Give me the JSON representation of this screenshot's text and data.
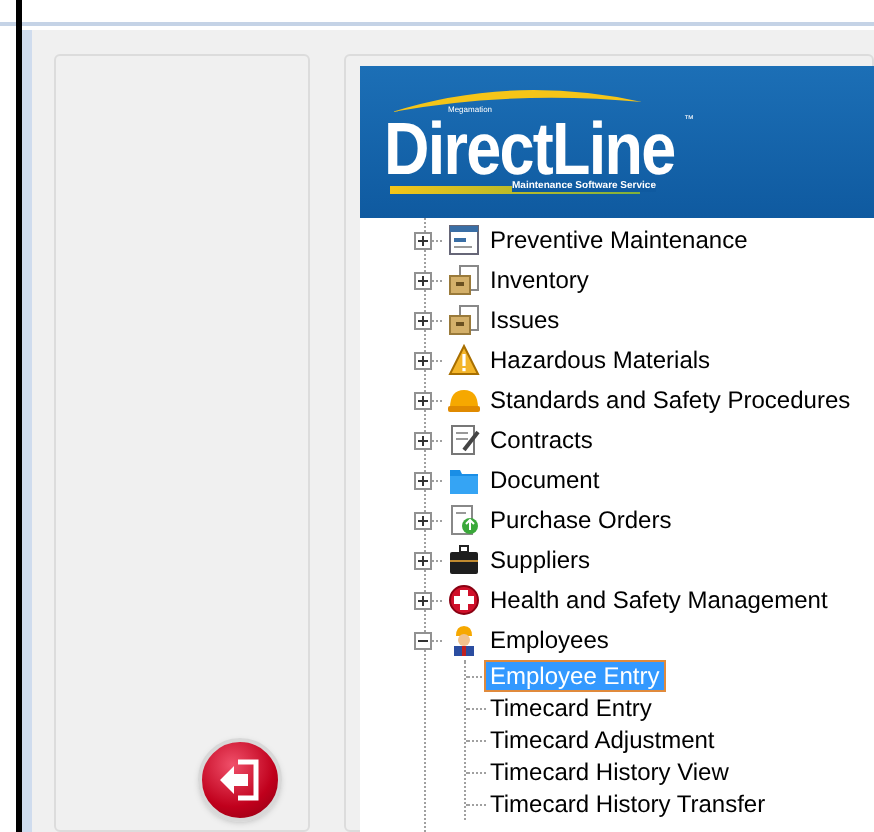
{
  "logo": {
    "brand": "DirectLine",
    "maker": "Megamation",
    "tagline": "Maintenance Software Service",
    "trademark": "™"
  },
  "tree": [
    {
      "label": "Preventive Maintenance",
      "kind": "form",
      "expanded": false
    },
    {
      "label": "Inventory",
      "kind": "box",
      "expanded": false
    },
    {
      "label": "Issues",
      "kind": "box",
      "expanded": false
    },
    {
      "label": "Hazardous Materials",
      "kind": "warning",
      "expanded": false
    },
    {
      "label": "Standards and Safety Procedures",
      "kind": "hardhat",
      "expanded": false
    },
    {
      "label": "Contracts",
      "kind": "note",
      "expanded": false
    },
    {
      "label": "Document",
      "kind": "folder",
      "expanded": false
    },
    {
      "label": "Purchase Orders",
      "kind": "order",
      "expanded": false
    },
    {
      "label": "Suppliers",
      "kind": "briefcase",
      "expanded": false
    },
    {
      "label": "Health and Safety Management",
      "kind": "cross",
      "expanded": false
    },
    {
      "label": "Employees",
      "kind": "worker",
      "expanded": true,
      "children": [
        {
          "label": "Employee Entry",
          "selected": true
        },
        {
          "label": "Timecard Entry",
          "selected": false
        },
        {
          "label": "Timecard Adjustment",
          "selected": false
        },
        {
          "label": "Timecard History View",
          "selected": false
        },
        {
          "label": "Timecard History Transfer",
          "selected": false
        }
      ]
    }
  ]
}
